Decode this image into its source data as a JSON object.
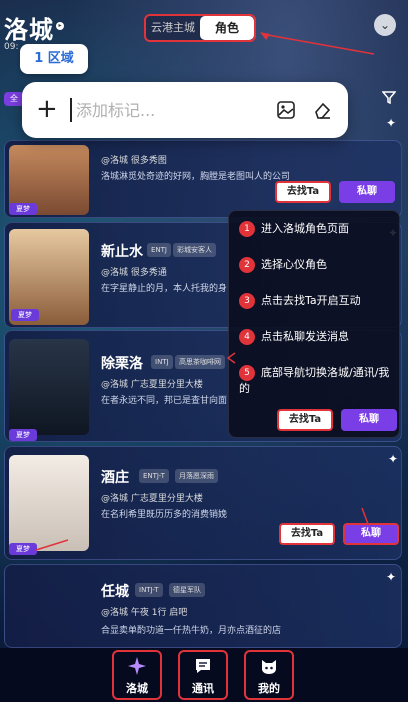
{
  "header": {
    "city_title": "洛城",
    "time": "09:",
    "tabs": [
      "云港主城",
      "角色"
    ],
    "active_tab": "角色",
    "region": "1 区域",
    "corner_badge": "全"
  },
  "add_bar": {
    "placeholder": "添加标记..."
  },
  "cards": [
    {
      "name": "",
      "location": "@洛城 很多秀图",
      "desc": "洛城淋觅处奇迹的好网，胸膛是老图叫人的公司",
      "dream": "夏梦",
      "find_label": "去找Ta",
      "chat_label": "私聊"
    },
    {
      "name": "新止水",
      "chip1": "ENTJ",
      "chip2": "彩城安客人",
      "location": "@洛城 很多秀通",
      "desc": "在字星静止的月，本人托我的身",
      "dream": "夏梦"
    },
    {
      "name": "除栗洛",
      "chip1": "INTJ",
      "chip2": "高思茶咖啡网",
      "location": "@洛城 广志夏里分里大楼",
      "desc": "在者永远不同，邦已是查甘向面",
      "dream": "夏梦"
    },
    {
      "name": "酒庄",
      "chip1": "ENTJ-T",
      "chip2": "月落愿深雨",
      "location": "@洛城 广志夏里分里大楼",
      "desc": "在名利希里既历历多的消费销娩",
      "dream": "夏梦",
      "find_label": "去找Ta",
      "chat_label": "私聊"
    },
    {
      "name": "任城",
      "chip1": "INTJ-T",
      "chip2": "德星军队",
      "location": "@洛城 午夜 1行 启吧",
      "desc": "合显卖单酌功道一仟热牛奶，月亦点酒征的店"
    }
  ],
  "guide": {
    "steps": [
      {
        "num": "1",
        "text": "进入洛城角色页面"
      },
      {
        "num": "2",
        "text": "选择心仪角色"
      },
      {
        "num": "3",
        "text": "点击去找Ta开启互动"
      },
      {
        "num": "4",
        "text": "点击私聊发送消息"
      },
      {
        "num": "5",
        "text": "底部导航切换洛城/通讯/我的"
      }
    ],
    "find_label": "去找Ta",
    "chat_label": "私聊"
  },
  "bottom_nav": [
    {
      "label": "洛城",
      "icon": "sparkle-icon"
    },
    {
      "label": "通讯",
      "icon": "message-icon"
    },
    {
      "label": "我的",
      "icon": "cat-face-icon"
    }
  ],
  "colors": {
    "accent_red": "#e0333a",
    "purple": "#7a3ee6",
    "region_blue": "#2a6bd6"
  }
}
